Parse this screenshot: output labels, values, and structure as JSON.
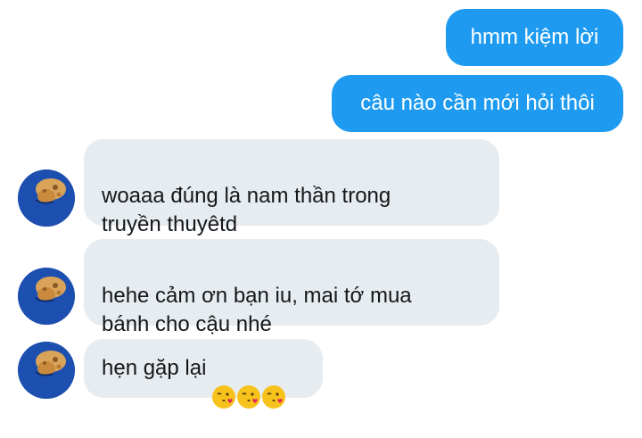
{
  "messages": {
    "sent": [
      {
        "text": "hmm kiệm lời"
      },
      {
        "text": "câu nào cần mới hỏi thôi"
      }
    ],
    "received": [
      {
        "text": "woaaa đúng là nam thần trong\ntruyền thuyêtd"
      },
      {
        "text": "hehe cảm ơn bạn iu, mai tớ mua\nbánh cho cậu nhé"
      },
      {
        "text": "hẹn gặp lại",
        "emojis": [
          "kissing-face-with-heart-icon",
          "kissing-face-with-heart-icon",
          "kissing-face-with-heart-icon"
        ]
      }
    ]
  },
  "colors": {
    "sent_bubble": "#1e9bf0",
    "received_bubble": "#e6ecf0",
    "received_text": "#14171a"
  }
}
